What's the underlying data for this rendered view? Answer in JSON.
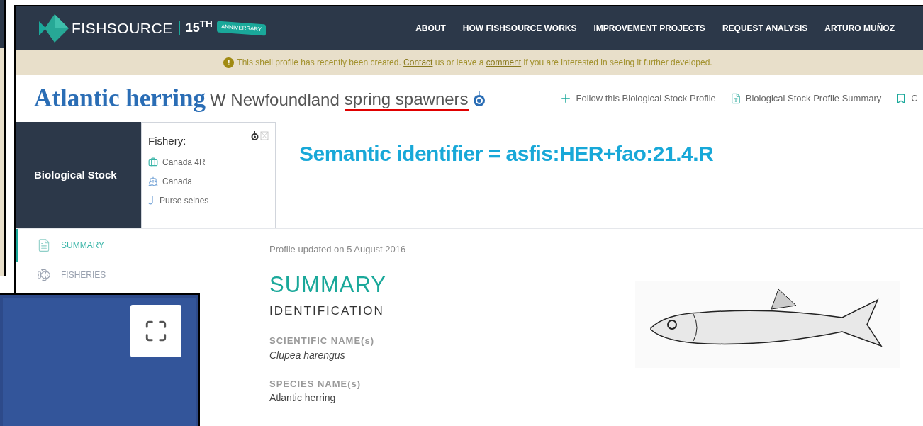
{
  "header": {
    "brand": "FISHSOURCE",
    "anniversary_number": "15$^{TH}$",
    "ribbon": "ANNIVERSARY",
    "nav": [
      "ABOUT",
      "HOW FISHSOURCE WORKS",
      "IMPROVEMENT PROJECTS",
      "REQUEST ANALYSIS",
      "ARTURO MUÑOZ"
    ]
  },
  "notice_icon": "!",
  "notice": [
    {
      "kind": "text",
      "text": "This shell profile has recently been created. "
    },
    {
      "kind": "link",
      "text": "Contact"
    },
    {
      "kind": "text",
      "text": " us or leave a "
    },
    {
      "kind": "link",
      "text": "comment"
    },
    {
      "kind": "text",
      "text": " if you are interested in seeing it further developed."
    }
  ],
  "profile": {
    "title": "Atlantic herring",
    "stock_prefix": "W Newfoundland",
    "stock_marked": "spring spawners",
    "actions": [
      {
        "kind": "follow",
        "label": "Follow this Biological Stock Profile"
      },
      {
        "kind": "pdf",
        "label": "Biological Stock Profile Summary"
      },
      {
        "kind": "bookmark",
        "label": "C"
      }
    ]
  },
  "stock_block": {
    "label": "Biological Stock"
  },
  "fishery": {
    "heading": "Fishery:",
    "items": [
      {
        "kind": "area",
        "label": "Canada 4R"
      },
      {
        "kind": "fleet",
        "label": "Canada"
      },
      {
        "kind": "gear",
        "label": "Purse seines"
      }
    ]
  },
  "annotation": "Semantic identifier = asfis:HER+fao:21.4.R",
  "sidebar": [
    {
      "kind": "summary",
      "label": "SUMMARY",
      "selected": true
    },
    {
      "kind": "fisheries",
      "label": "FISHERIES",
      "selected": false
    }
  ],
  "content": {
    "updated": "Profile updated on 5 August 2016",
    "section": "SUMMARY",
    "subsection": "IDENTIFICATION",
    "fields": [
      {
        "label": "SCIENTIFIC NAME(s)",
        "value": "Clupea harengus",
        "italic": true
      },
      {
        "label": "SPECIES NAME(s)",
        "value": "Atlantic herring",
        "italic": false
      }
    ]
  }
}
